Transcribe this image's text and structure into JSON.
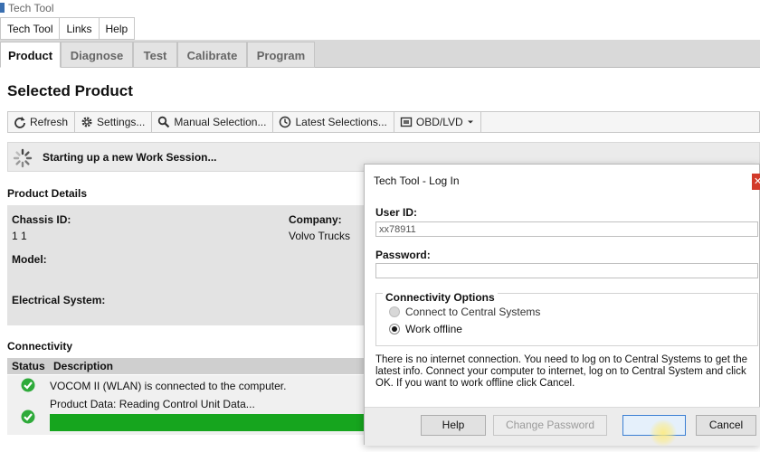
{
  "window": {
    "title": "Tech Tool"
  },
  "menu": {
    "items": [
      "Tech Tool",
      "Links",
      "Help"
    ]
  },
  "tabs": [
    "Product",
    "Diagnose",
    "Test",
    "Calibrate",
    "Program"
  ],
  "page": {
    "title": "Selected Product"
  },
  "toolbar": {
    "refresh": "Refresh",
    "settings": "Settings...",
    "manual_selection": "Manual Selection...",
    "latest_selections": "Latest Selections...",
    "obd": "OBD/LVD"
  },
  "status": {
    "message": "Starting up a new Work Session..."
  },
  "product_details": {
    "heading": "Product Details",
    "chassis_id_label": "Chassis ID:",
    "chassis_id_value": "1 1",
    "company_label": "Company:",
    "company_value": "Volvo Trucks",
    "model_label": "Model:",
    "electrical_system_label": "Electrical System:"
  },
  "connectivity": {
    "heading": "Connectivity",
    "col_status": "Status",
    "col_description": "Description",
    "rows": [
      {
        "description": "VOCOM II (WLAN) is connected to the computer."
      },
      {
        "description": "Product Data: Reading Control Unit Data..."
      }
    ]
  },
  "dialog": {
    "title": "Tech Tool - Log In",
    "user_id_label": "User ID:",
    "user_id_value": "xx78911",
    "password_label": "Password:",
    "password_value": "",
    "options_title": "Connectivity Options",
    "option_central": "Connect to Central Systems",
    "option_offline": "Work offline",
    "selected_option": "Work offline",
    "message": "There is no internet connection. You need to log on to Central Systems to get the latest info. Connect your computer to internet, log on to Central System and click OK. If you want to work offline click Cancel.",
    "help_button": "Help",
    "change_password_button": "Change Password",
    "ok_button": "",
    "cancel_button": "Cancel"
  },
  "colors": {
    "accent_green": "#16a51e",
    "check_green": "#2eaa3a",
    "close_red": "#d23a2a",
    "focus_blue": "#3b7fd3"
  },
  "icons": [
    "refresh-icon",
    "gear-icon",
    "search-icon",
    "clock-icon",
    "obd-icon",
    "spinner-icon",
    "check-icon",
    "close-icon"
  ]
}
